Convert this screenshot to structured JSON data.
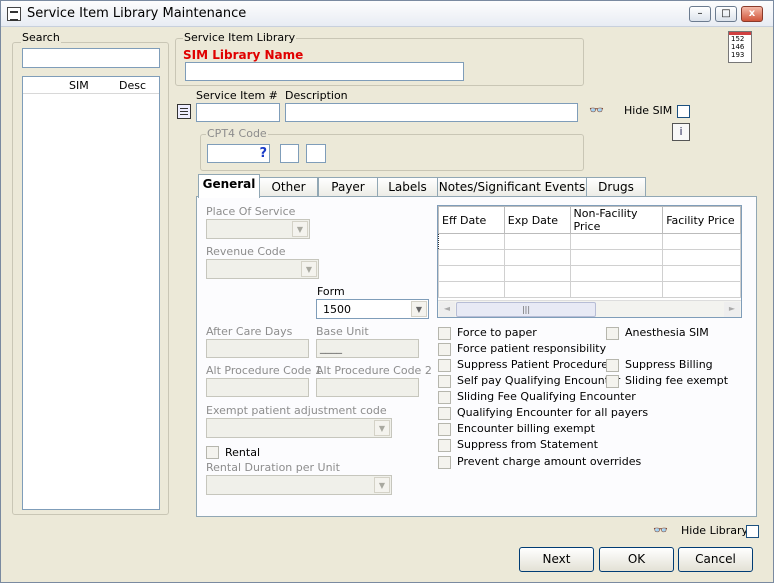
{
  "window": {
    "title": "Service Item Library Maintenance",
    "minimize": "–",
    "maximize": "□",
    "close": "x"
  },
  "search": {
    "label": "Search",
    "value": "",
    "columns": [
      "SIM",
      "Desc"
    ]
  },
  "library": {
    "group_label": "Service Item Library",
    "name_label": "SIM Library Name",
    "name_value": ""
  },
  "item": {
    "service_item_label": "Service Item #",
    "service_item_value": "",
    "description_label": "Description",
    "description_value": "",
    "hide_sim_label": "Hide SIM"
  },
  "cpt4": {
    "label": "CPT4 Code",
    "lookup": "?",
    "value": ""
  },
  "date_icon": {
    "lines": [
      "152",
      "146",
      "193"
    ]
  },
  "tabs": [
    {
      "label": "General"
    },
    {
      "label": "Other"
    },
    {
      "label": "Payer"
    },
    {
      "label": "Labels"
    },
    {
      "label": "Notes/Significant Events"
    },
    {
      "label": "Drugs"
    }
  ],
  "general": {
    "place_of_service": "Place Of Service",
    "revenue_code": "Revenue Code",
    "form_label": "Form",
    "form_value": "1500",
    "after_care_days": "After Care Days",
    "base_unit": "Base Unit",
    "base_unit_value": "____",
    "alt_code_1": "Alt Procedure Code 1",
    "alt_code_2": "Alt Procedure Code 2",
    "exempt_label": "Exempt patient adjustment code",
    "rental_label": "Rental",
    "rental_duration": "Rental Duration per Unit"
  },
  "price_grid": {
    "columns": [
      "Eff Date",
      "Exp Date",
      "Non-Facility Price",
      "Facility Price"
    ],
    "rows": [
      [
        "",
        "",
        "",
        ""
      ],
      [
        "",
        "",
        "",
        ""
      ],
      [
        "",
        "",
        "",
        ""
      ],
      [
        "",
        "",
        "",
        ""
      ]
    ],
    "scroll_left": "◄",
    "scroll_thumb": "|||",
    "scroll_right": "►"
  },
  "checkboxes_left": [
    "Force to paper",
    "Force patient responsibility",
    "Suppress Patient Procedure",
    "Self pay Qualifying Encounter",
    "Sliding Fee Qualifying Encounter",
    "Qualifying Encounter for all payers",
    "Encounter billing exempt",
    "Suppress from Statement",
    "Prevent charge amount overrides"
  ],
  "checkboxes_right": [
    "Anesthesia SIM",
    "Suppress Billing",
    "Sliding fee exempt"
  ],
  "footer": {
    "hide_library_label": "Hide Library",
    "next": "Next",
    "ok": "OK",
    "cancel": "Cancel"
  }
}
